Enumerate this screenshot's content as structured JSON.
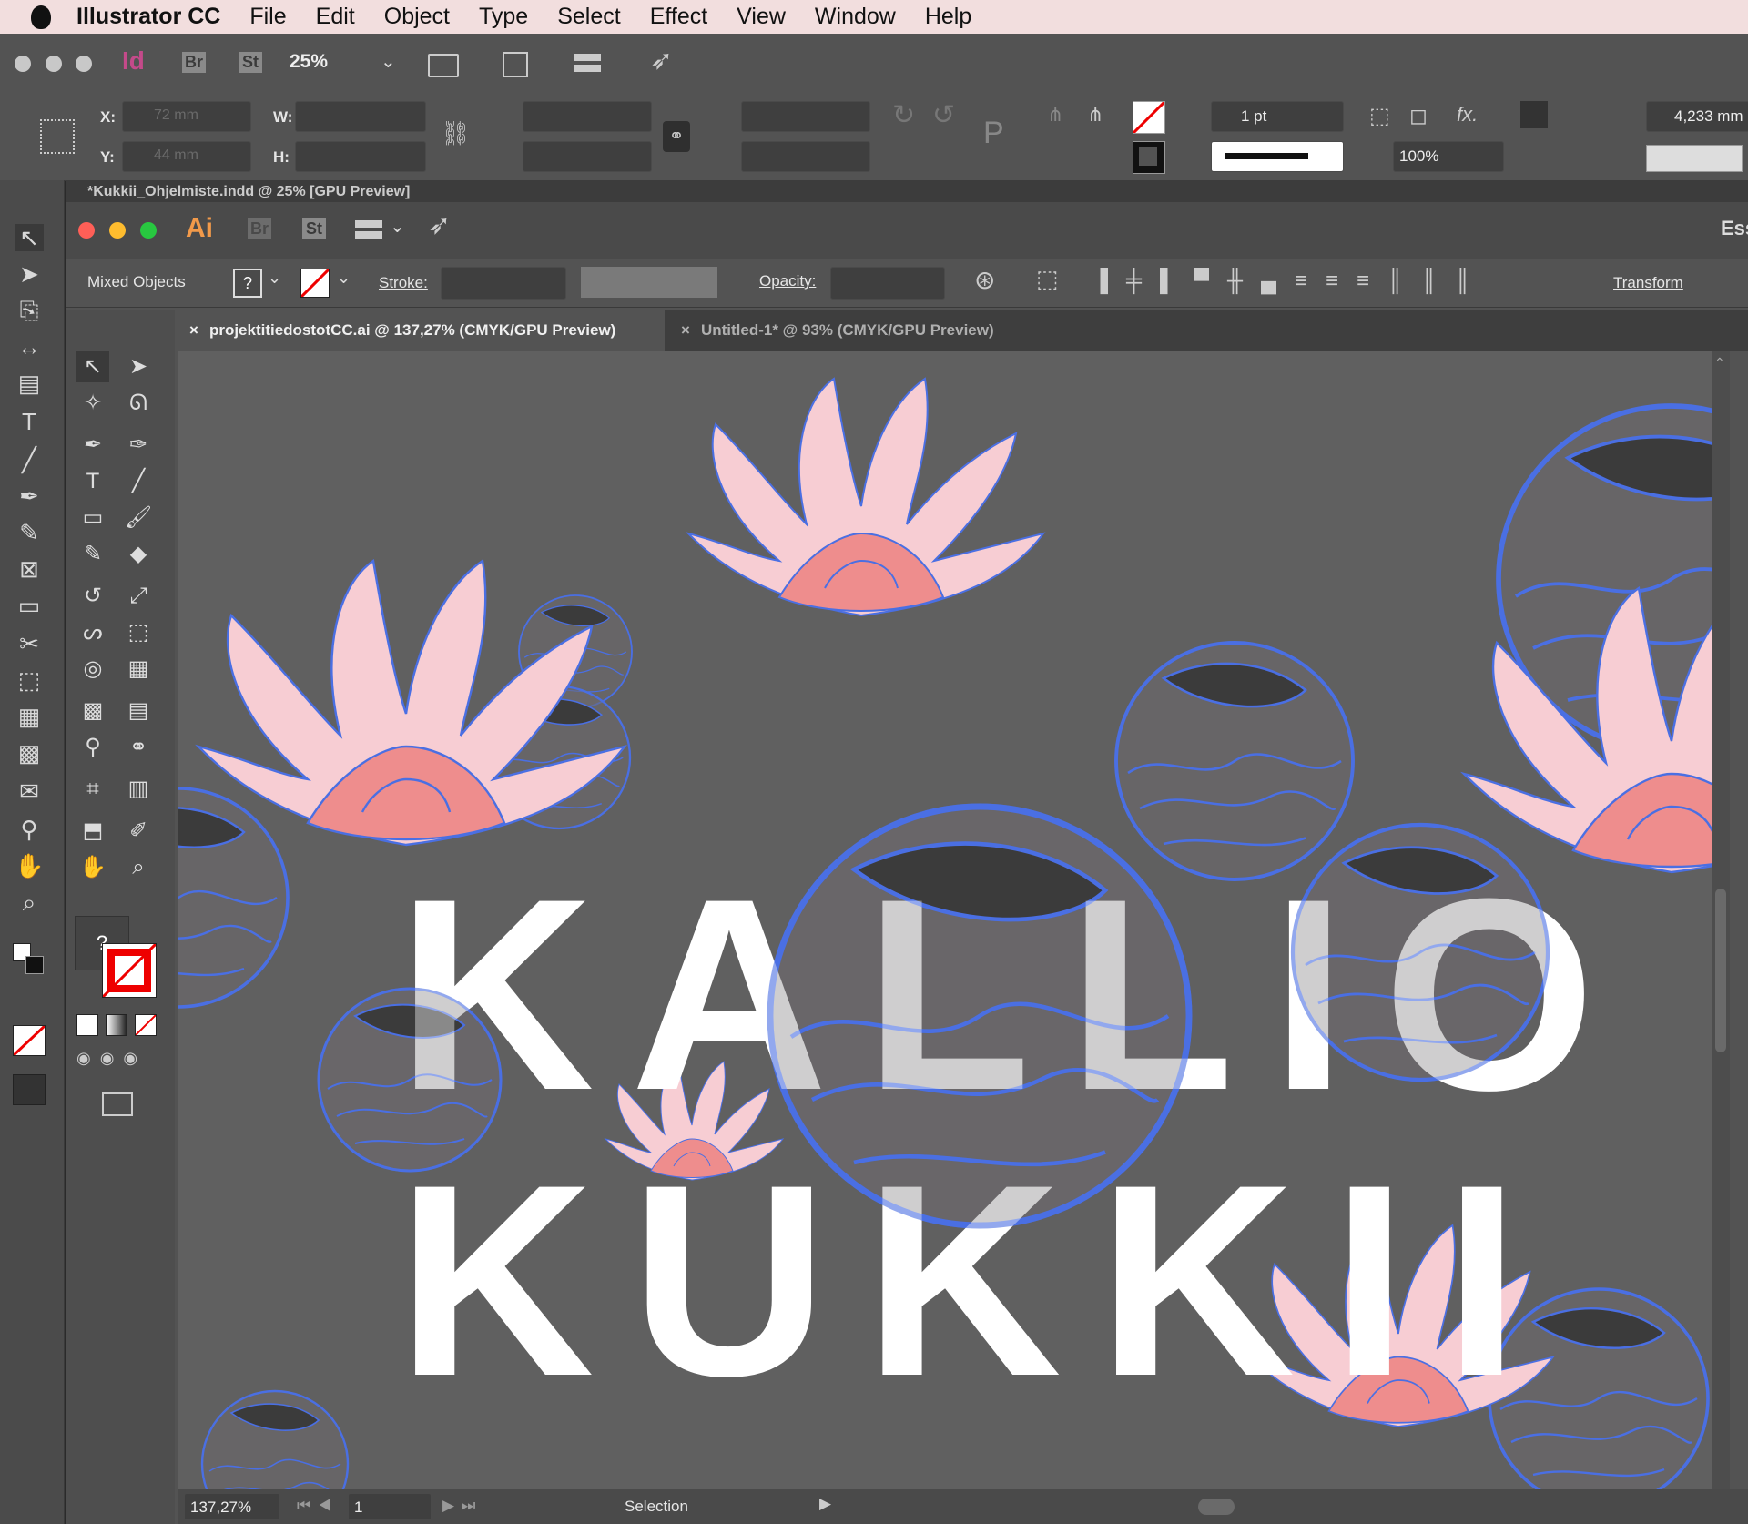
{
  "menubar": {
    "app_name": "Illustrator CC",
    "items": [
      "File",
      "Edit",
      "Object",
      "Type",
      "Select",
      "Effect",
      "View",
      "Window",
      "Help"
    ]
  },
  "indesign": {
    "badges": {
      "id": "Id",
      "br": "Br",
      "st": "St"
    },
    "zoom": "25%",
    "x_label": "X:",
    "y_label": "Y:",
    "w_label": "W:",
    "h_label": "H:",
    "x_value": "72 mm",
    "y_value": "44 mm",
    "stroke_weight": "1 pt",
    "tint": "100%",
    "spacing_value": "4,233 mm",
    "doc_tab": "*Kukkii_Ohjelmiste.indd @ 25% [GPU Preview]"
  },
  "illustrator": {
    "badges": {
      "ai": "Ai",
      "br": "Br",
      "st": "St"
    },
    "workspace": "Ess",
    "selection_type": "Mixed Objects",
    "fill_glyph": "?",
    "stroke_label": "Stroke:",
    "opacity_label": "Opacity:",
    "transform_label": "Transform",
    "tabs": [
      {
        "label": "projektitiedostotCC.ai @ 137,27% (CMYK/GPU Preview)",
        "close": "×"
      },
      {
        "label": "Untitled-1* @ 93% (CMYK/GPU Preview)",
        "close": "×"
      }
    ],
    "status": {
      "zoom": "137,27%",
      "page": "1",
      "tool": "Selection"
    }
  },
  "artwork": {
    "line1": "KALLIO",
    "line2": "KUKKII"
  },
  "colors": {
    "outline": "#4a6fe3",
    "petal": "#f7cdd3",
    "petal_dark": "#ee8d8d",
    "canvas": "#606060"
  }
}
